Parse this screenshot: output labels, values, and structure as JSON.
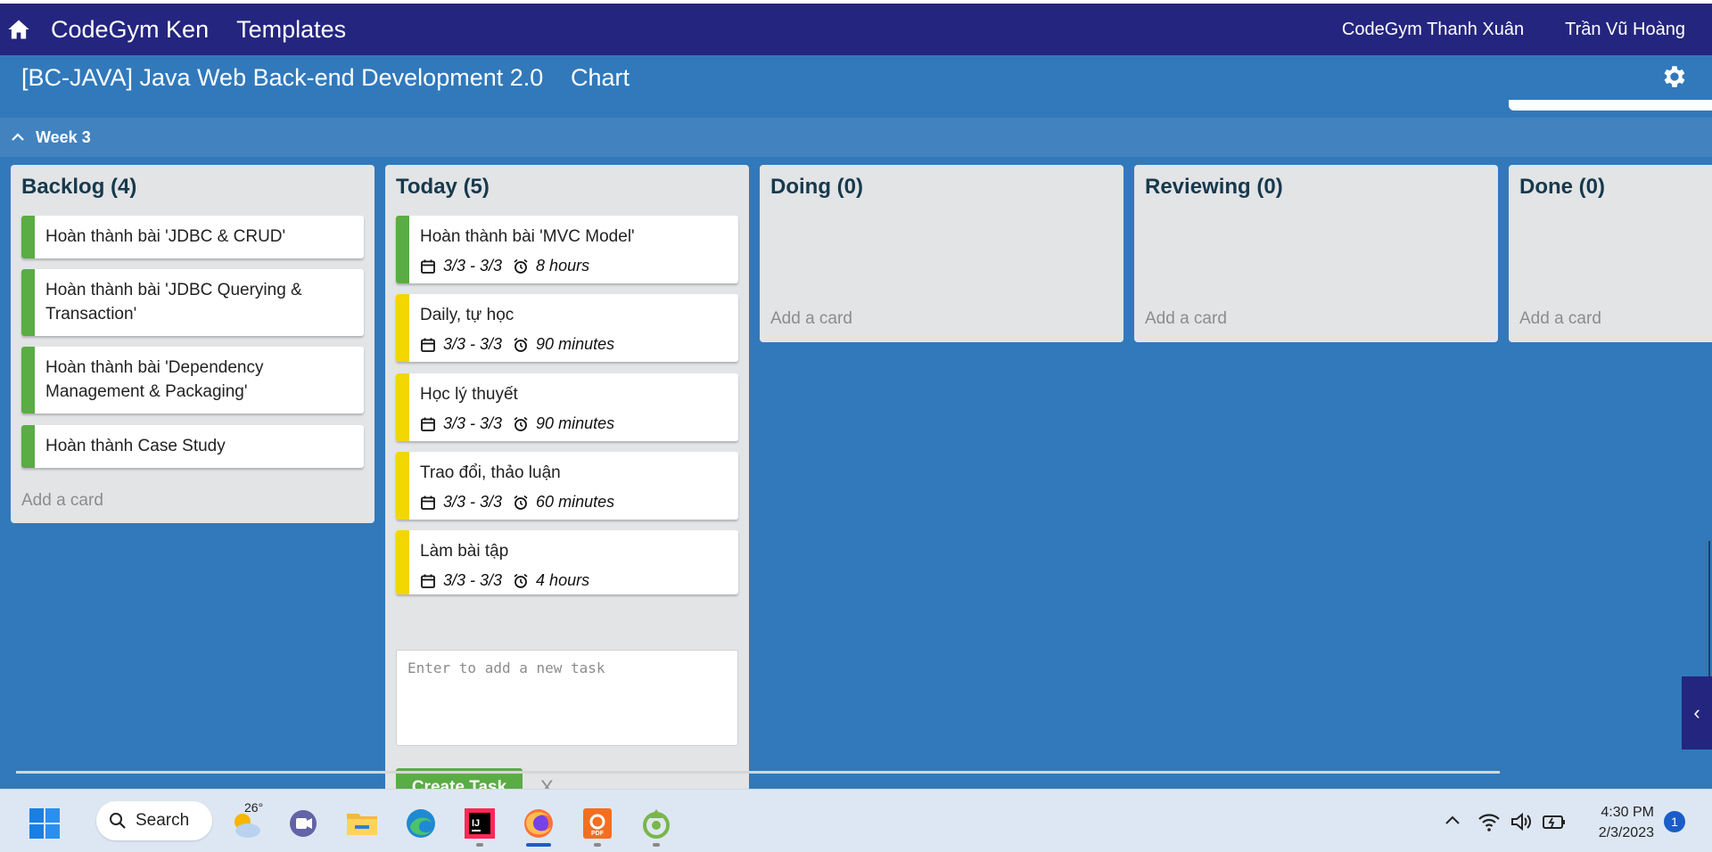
{
  "topbar": {
    "home_icon": "home-icon",
    "brand": "CodeGym Ken",
    "templates": "Templates",
    "org": "CodeGym Thanh Xuân",
    "user": "Trần Vũ Hoàng",
    "bg_color": "#24257e"
  },
  "board": {
    "title": "[BC-JAVA] Java Web Back-end Development 2.0",
    "chart_link": "Chart",
    "settings_icon": "gear-icon",
    "bg_color": "#3179ba"
  },
  "week": {
    "label": "Week 3",
    "icon": "chevron-up-icon"
  },
  "lists": {
    "backlog": {
      "title": "Backlog (4)",
      "cards": [
        {
          "text": "Hoàn thành bài 'JDBC & CRUD'"
        },
        {
          "text": "Hoàn thành bài 'JDBC Querying & Transaction'"
        },
        {
          "text": "Hoàn thành bài 'Dependency Management & Packaging'"
        },
        {
          "text": "Hoàn thành Case Study"
        }
      ],
      "add_card": "Add a card"
    },
    "today": {
      "title": "Today (5)",
      "cards": [
        {
          "text": "Hoàn thành bài 'MVC Model'",
          "date": "3/3 - 3/3",
          "duration": "8 hours"
        },
        {
          "text": "Daily, tự học",
          "date": "3/3 - 3/3",
          "duration": "90 minutes"
        },
        {
          "text": "Học lý thuyết",
          "date": "3/3 - 3/3",
          "duration": "90 minutes"
        },
        {
          "text": "Trao đổi, thảo luận",
          "date": "3/3 - 3/3",
          "duration": "60 minutes"
        },
        {
          "text": "Làm bài tập",
          "date": "3/3 - 3/3",
          "duration": "4 hours"
        }
      ],
      "task_input_placeholder": "Enter to add a new task",
      "create_button": "Create Task",
      "cancel": "X"
    },
    "doing": {
      "title": "Doing (0)",
      "add_card": "Add a card"
    },
    "reviewing": {
      "title": "Reviewing (0)",
      "add_card": "Add a card"
    },
    "done": {
      "title": "Done (0)",
      "add_card": "Add a card"
    }
  },
  "colors": {
    "green_label": "#5aac44",
    "yellow_label": "#f2d600",
    "create_button": "#5aac44"
  },
  "side_toggle": "‹",
  "taskbar": {
    "search_label": "Search",
    "weather_temp": "26°",
    "apps": [
      "windows-start-icon",
      "weather-icon",
      "teams-chat-icon",
      "file-explorer-icon",
      "edge-icon",
      "intellij-icon",
      "firefox-icon",
      "foxit-pdf-icon",
      "greenshot-icon"
    ],
    "tray": [
      "chevron-up-icon",
      "wifi-icon",
      "volume-icon",
      "battery-icon"
    ],
    "time": "4:30 PM",
    "date": "2/3/2023",
    "notification_count": "1"
  }
}
